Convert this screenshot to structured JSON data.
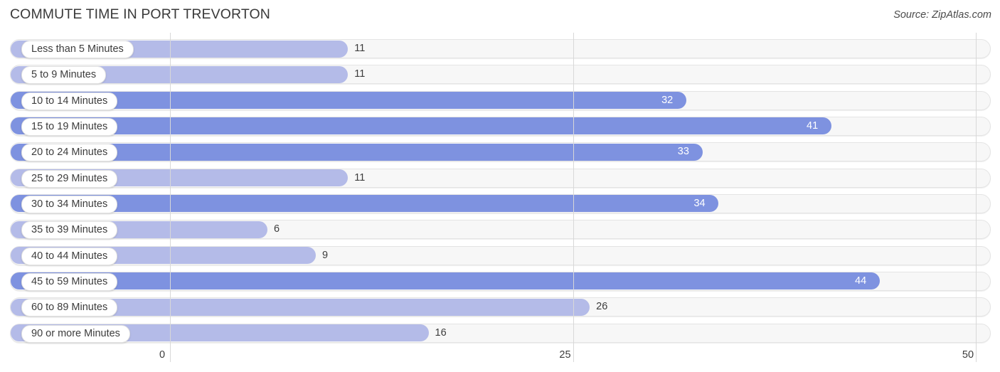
{
  "header": {
    "title": "COMMUTE TIME IN PORT TREVORTON",
    "source": "Source: ZipAtlas.com"
  },
  "axis": {
    "ticks": [
      "0",
      "25",
      "50"
    ]
  },
  "colors": {
    "bar_light": "#b4bbe8",
    "bar_dark": "#7e92e0",
    "track_fill": "#f7f7f7",
    "track_border": "#e4e4e4",
    "gridline": "#d8d8d8",
    "value_inside": "#ffffff",
    "value_outside": "#3c3c3c",
    "title": "#3a3a3a"
  },
  "chart_data": {
    "type": "bar",
    "orientation": "horizontal",
    "title": "COMMUTE TIME IN PORT TREVORTON",
    "xlabel": "",
    "ylabel": "",
    "xlim": [
      0,
      50
    ],
    "xticks": [
      0,
      25,
      50
    ],
    "grid": true,
    "legend": false,
    "source": "Source: ZipAtlas.com",
    "categories": [
      "Less than 5 Minutes",
      "5 to 9 Minutes",
      "10 to 14 Minutes",
      "15 to 19 Minutes",
      "20 to 24 Minutes",
      "25 to 29 Minutes",
      "30 to 34 Minutes",
      "35 to 39 Minutes",
      "40 to 44 Minutes",
      "45 to 59 Minutes",
      "60 to 89 Minutes",
      "90 or more Minutes"
    ],
    "values": [
      11,
      11,
      32,
      41,
      33,
      11,
      34,
      6,
      9,
      44,
      26,
      16
    ],
    "bars": [
      {
        "label": "Less than 5 Minutes",
        "value": 11,
        "value_text": "11",
        "shade": "light",
        "label_inside": true
      },
      {
        "label": "5 to 9 Minutes",
        "value": 11,
        "value_text": "11",
        "shade": "light",
        "label_inside": true
      },
      {
        "label": "10 to 14 Minutes",
        "value": 32,
        "value_text": "32",
        "shade": "dark",
        "label_inside": true
      },
      {
        "label": "15 to 19 Minutes",
        "value": 41,
        "value_text": "41",
        "shade": "dark",
        "label_inside": true
      },
      {
        "label": "20 to 24 Minutes",
        "value": 33,
        "value_text": "33",
        "shade": "dark",
        "label_inside": true
      },
      {
        "label": "25 to 29 Minutes",
        "value": 11,
        "value_text": "11",
        "shade": "light",
        "label_inside": true
      },
      {
        "label": "30 to 34 Minutes",
        "value": 34,
        "value_text": "34",
        "shade": "dark",
        "label_inside": true
      },
      {
        "label": "35 to 39 Minutes",
        "value": 6,
        "value_text": "6",
        "shade": "light",
        "label_inside": true
      },
      {
        "label": "40 to 44 Minutes",
        "value": 9,
        "value_text": "9",
        "shade": "light",
        "label_inside": true
      },
      {
        "label": "45 to 59 Minutes",
        "value": 44,
        "value_text": "44",
        "shade": "dark",
        "label_inside": true
      },
      {
        "label": "60 to 89 Minutes",
        "value": 26,
        "value_text": "26",
        "shade": "light",
        "label_inside": true
      },
      {
        "label": "90 or more Minutes",
        "value": 16,
        "value_text": "16",
        "shade": "light",
        "label_inside": true
      }
    ]
  }
}
